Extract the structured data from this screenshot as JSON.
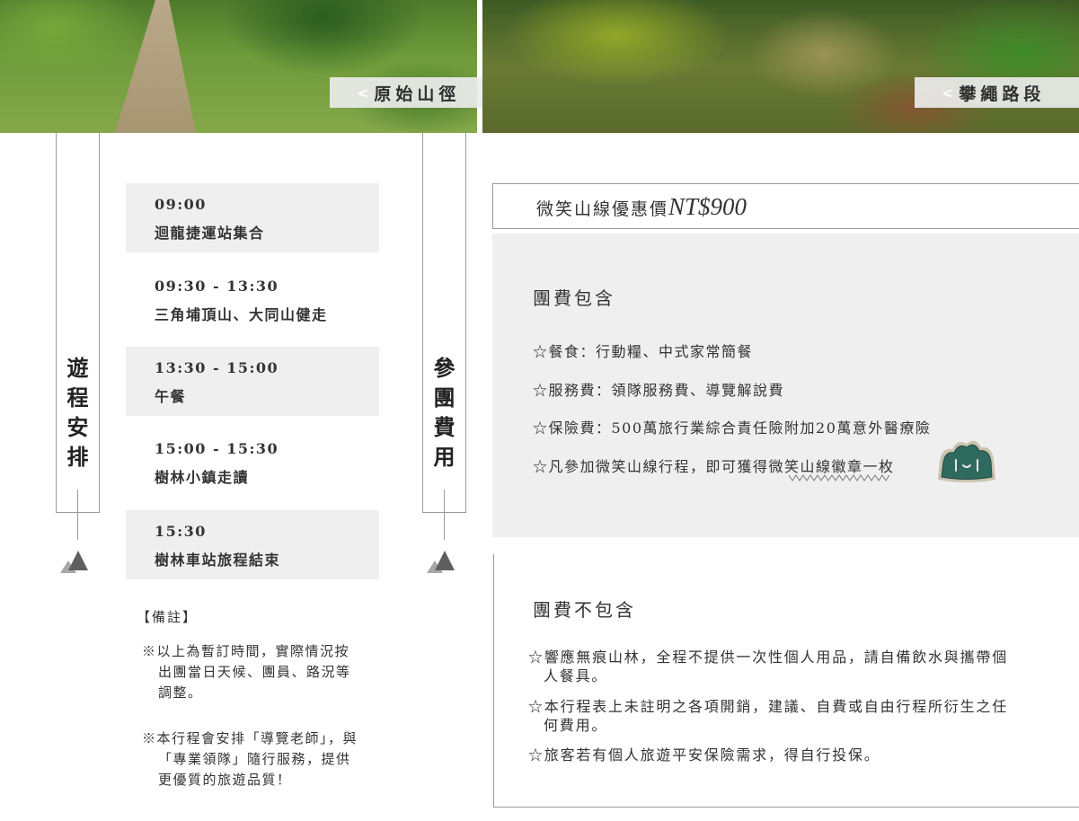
{
  "photos": {
    "left_label": "原始山徑",
    "right_label": "攀繩路段",
    "chevron": "<"
  },
  "itinerary": {
    "heading": [
      "遊",
      "程",
      "安",
      "排"
    ],
    "items": [
      {
        "time": "09:00",
        "desc": "迴龍捷運站集合"
      },
      {
        "time": "09:30 - 13:30",
        "desc": "三角埔頂山、大同山健走"
      },
      {
        "time": "13:30 - 15:00",
        "desc": "午餐"
      },
      {
        "time": "15:00 - 15:30",
        "desc": "樹林小鎮走讀"
      },
      {
        "time": "15:30",
        "desc": "樹林車站旅程結束"
      }
    ],
    "notes_title": "【備註】",
    "notes": [
      "※以上為暫訂時間，實際情況按出團當日天候、團員、路況等調整。",
      "※本行程會安排「導覽老師」，與「專業領隊」隨行服務，提供更優質的旅遊品質！"
    ]
  },
  "fees": {
    "heading": [
      "參",
      "團",
      "費",
      "用"
    ],
    "price_label": "微笑山線優惠價",
    "price_amount": "NT$900",
    "included_title": "團費包含",
    "included": [
      "☆餐食：行動糧、中式家常簡餐",
      "☆服務費：領隊服務費、導覽解說費",
      "☆保險費：500萬旅行業綜合責任險附加20萬意外醫療險",
      "☆凡參加微笑山線行程，即可獲得微笑山線徽章一枚"
    ],
    "excluded_title": "團費不包含",
    "excluded": [
      "☆響應無痕山林，全程不提供一次性個人用品，請自備飲水與攜帶個人餐具。",
      "☆本行程表上未註明之各項開銷，建議、自費或自由行程所衍生之任何費用。",
      "☆旅客若有個人旅遊平安保險需求，得自行投保。"
    ]
  },
  "colors": {
    "badge_green": "#2e6b5e",
    "shade": "#efefef",
    "rule": "#9a9a9a"
  },
  "icons": {
    "badge": "mountain-badge-icon",
    "triangle": "mountain-triangle-icon"
  }
}
